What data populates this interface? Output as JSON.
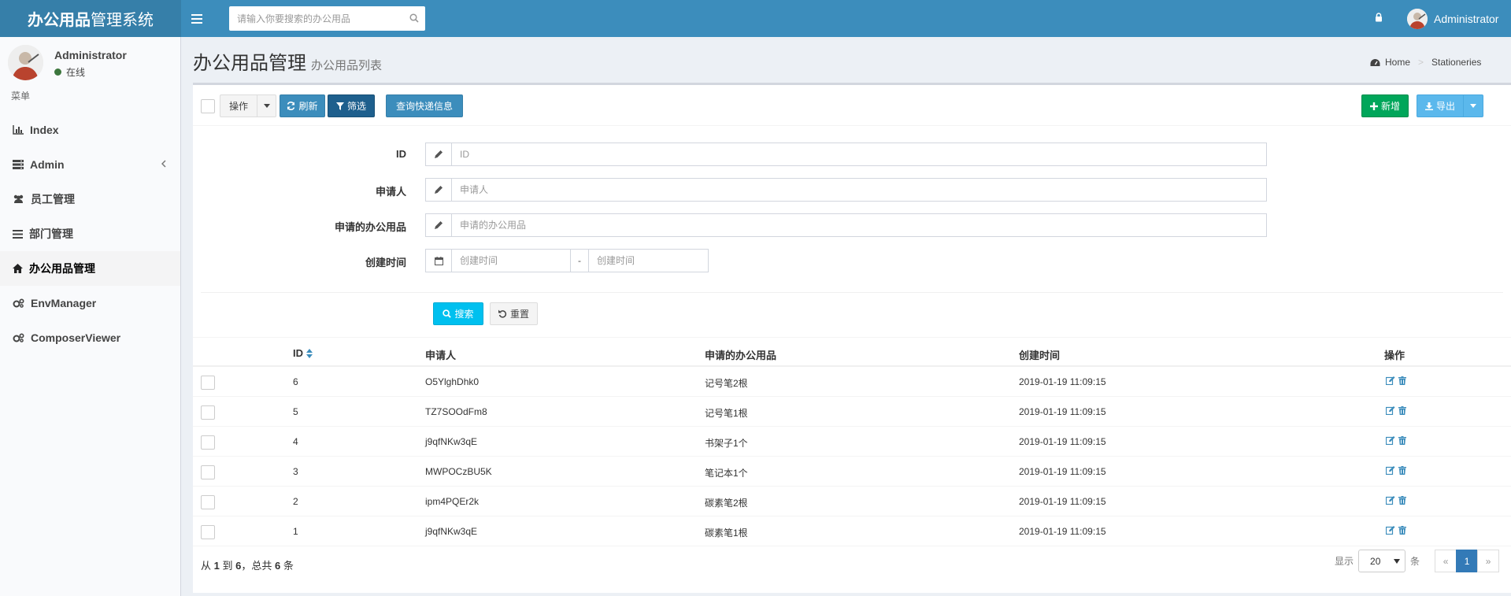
{
  "header": {
    "logo_bold": "办公用品",
    "logo_rest": "管理系统",
    "search_placeholder": "请输入你要搜索的办公用品",
    "user_name": "Administrator"
  },
  "sidebar": {
    "user_name": "Administrator",
    "status": "在线",
    "menu_header": "菜单",
    "items": [
      {
        "label": "Index",
        "icon": "bar-chart-icon"
      },
      {
        "label": "Admin",
        "icon": "server-icon"
      },
      {
        "label": "员工管理",
        "icon": "users-icon"
      },
      {
        "label": "部门管理",
        "icon": "list-icon"
      },
      {
        "label": "办公用品管理",
        "icon": "home-icon"
      },
      {
        "label": "EnvManager",
        "icon": "cogs-icon"
      },
      {
        "label": "ComposerViewer",
        "icon": "cogs-icon"
      }
    ]
  },
  "page": {
    "title": "办公用品管理",
    "subtitle": "办公用品列表",
    "breadcrumb_home": "Home",
    "breadcrumb_current": "Stationeries"
  },
  "toolbar": {
    "actions_label": "操作",
    "refresh_label": "刷新",
    "filter_label": "筛选",
    "express_label": "查询快递信息",
    "new_label": "新增",
    "export_label": "导出"
  },
  "filter": {
    "id_label": "ID",
    "id_placeholder": "ID",
    "applicant_label": "申请人",
    "applicant_placeholder": "申请人",
    "item_label": "申请的办公用品",
    "item_placeholder": "申请的办公用品",
    "time_label": "创建时间",
    "time_start_placeholder": "创建时间",
    "time_sep": "-",
    "time_end_placeholder": "创建时间",
    "search_label": "搜索",
    "reset_label": "重置"
  },
  "table": {
    "columns": [
      "ID",
      "申请人",
      "申请的办公用品",
      "创建时间",
      "操作"
    ],
    "rows": [
      {
        "id": "6",
        "applicant": "O5YlghDhk0",
        "item": "记号笔2根",
        "created": "2019-01-19 11:09:15"
      },
      {
        "id": "5",
        "applicant": "TZ7SOOdFm8",
        "item": "记号笔1根",
        "created": "2019-01-19 11:09:15"
      },
      {
        "id": "4",
        "applicant": "j9qfNKw3qE",
        "item": "书架子1个",
        "created": "2019-01-19 11:09:15"
      },
      {
        "id": "3",
        "applicant": "MWPOCzBU5K",
        "item": "笔记本1个",
        "created": "2019-01-19 11:09:15"
      },
      {
        "id": "2",
        "applicant": "ipm4PQEr2k",
        "item": "碳素笔2根",
        "created": "2019-01-19 11:09:15"
      },
      {
        "id": "1",
        "applicant": "j9qfNKw3qE",
        "item": "碳素笔1根",
        "created": "2019-01-19 11:09:15"
      }
    ]
  },
  "footer": {
    "summary_from": "从",
    "summary_start": "1",
    "summary_to": "到",
    "summary_end": "6",
    "summary_total_pre": "，总共",
    "summary_total": "6",
    "summary_unit": "条",
    "show_label": "显示",
    "per_page": "20",
    "per_page_unit": "条",
    "prev": "«",
    "current_page": "1",
    "next": "»"
  },
  "colors": {
    "header_bg": "#3c8dbc",
    "logo_bg": "#367fa9",
    "success": "#00a65a",
    "info": "#00c0ef",
    "active_page": "#337ab7"
  }
}
